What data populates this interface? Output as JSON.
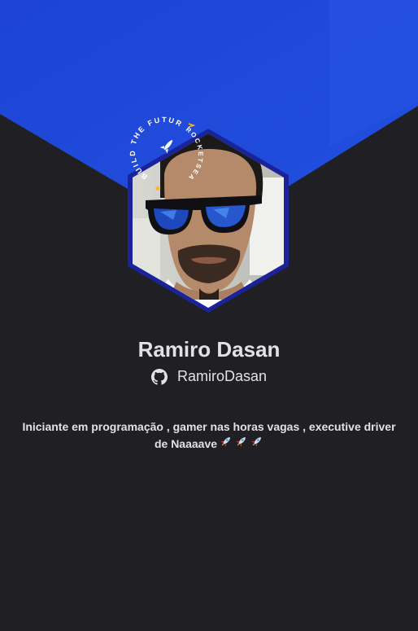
{
  "profile": {
    "name": "Ramiro Dasan",
    "github_username": "RamiroDasan",
    "bio": "Iniciante em programação , gamer nas horas vagas , executive driver de Naaaave",
    "bio_emoji": [
      "rocket-icon",
      "rocket-icon",
      "rocket-icon"
    ],
    "badge_text_left": "BUILD THE FUTURE",
    "badge_text_right": "ROCKETSEAT"
  },
  "colors": {
    "background": "#202024",
    "banner": "#1e46d8",
    "hex_border": "#1a2aa0",
    "text": "#e1e1e6"
  }
}
